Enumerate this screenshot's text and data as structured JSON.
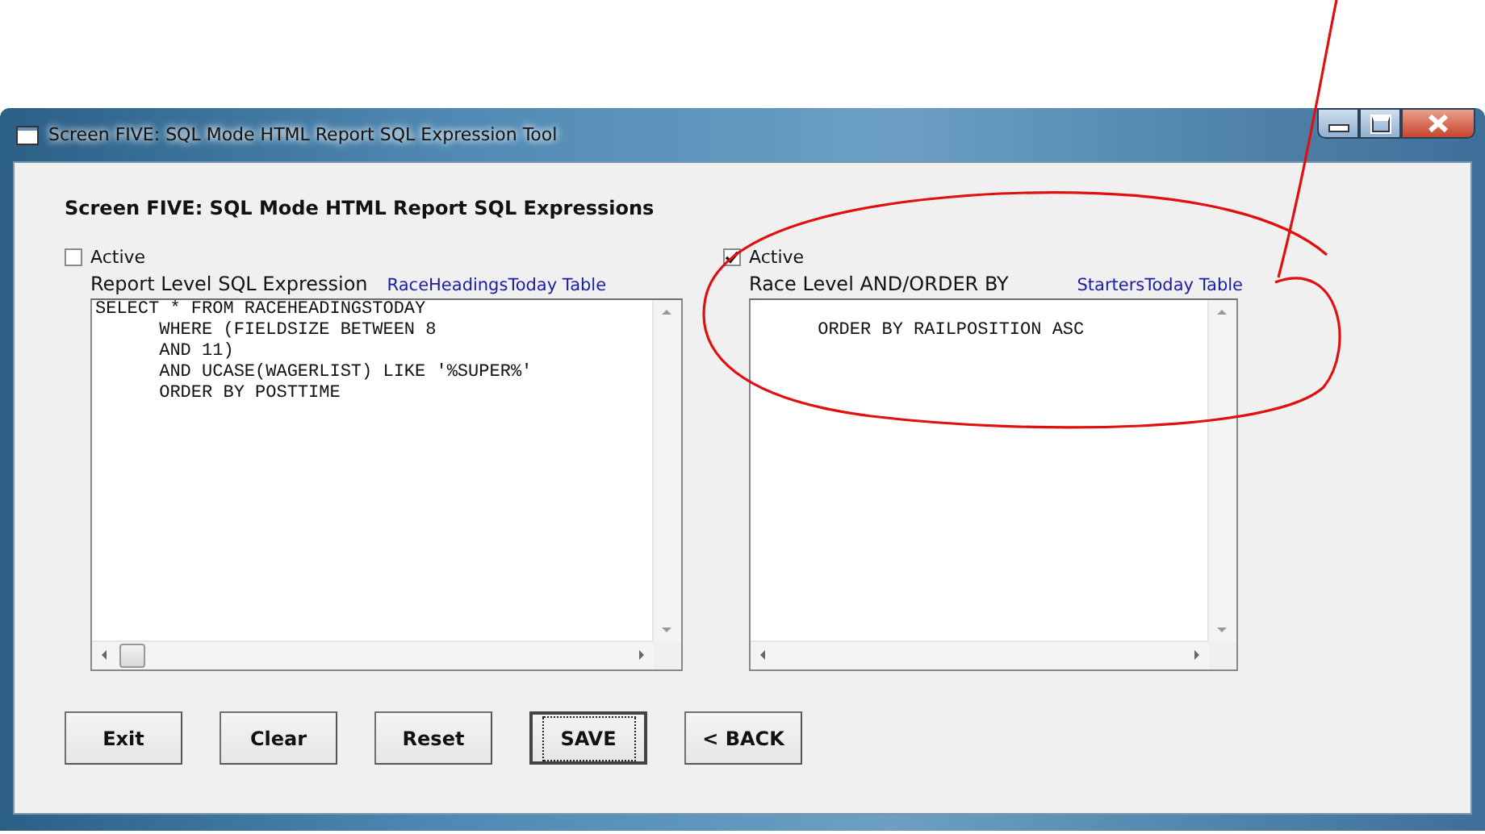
{
  "window": {
    "title": "Screen FIVE: SQL Mode HTML Report SQL Expression Tool"
  },
  "heading": "Screen FIVE: SQL Mode HTML Report SQL Expressions",
  "panels": [
    {
      "active": false,
      "active_label": "Active",
      "label": "Report Level SQL Expression",
      "link": "RaceHeadingsToday Table",
      "lines": [
        "SELECT * FROM RACEHEADINGSTODAY",
        "      WHERE (FIELDSIZE BETWEEN 8",
        "      AND 11)",
        "      AND UCASE(WAGERLIST) LIKE '%SUPER%'",
        "      ORDER BY POSTTIME"
      ]
    },
    {
      "active": true,
      "active_label": "Active",
      "label": "Race Level AND/ORDER BY",
      "link": "StartersToday Table",
      "lines": [
        "      ORDER BY RAILPOSITION ASC"
      ]
    }
  ],
  "buttons": [
    {
      "label": "Exit",
      "focused": false
    },
    {
      "label": "Clear",
      "focused": false
    },
    {
      "label": "Reset",
      "focused": false
    },
    {
      "label": "SAVE",
      "focused": true
    },
    {
      "label": "< BACK",
      "focused": false
    }
  ]
}
